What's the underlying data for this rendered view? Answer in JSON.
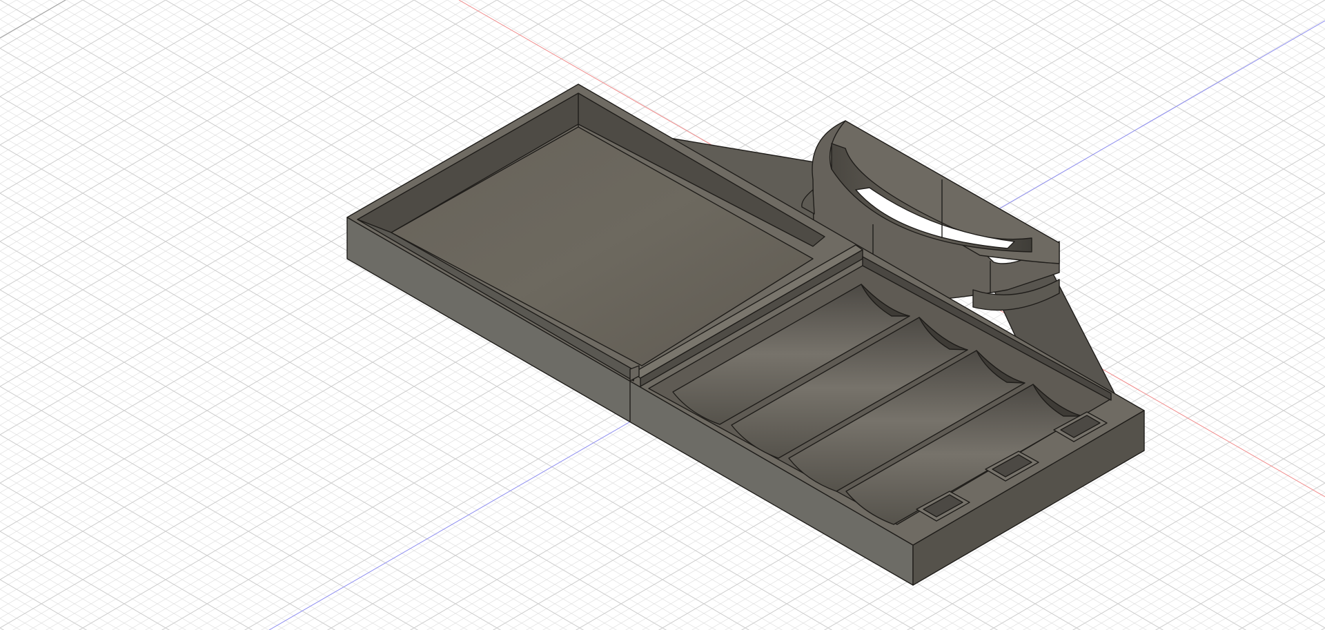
{
  "app": {
    "name": ""
  },
  "viewport": {
    "projection": "isometric",
    "grid_visible": true,
    "colors": {
      "background": "#ffffff",
      "grid_minor": "#e4e4e4",
      "grid_major": "#cfcfcf",
      "x_axis": "#f08a8a",
      "z_axis": "#8c8cf0",
      "part_top": "#6e6a62",
      "part_side_left": "#6f6e68",
      "part_side_right": "#55524b",
      "part_edge": "#1f1d1a"
    }
  },
  "model": {
    "body_name": "",
    "features": [
      "large-open-tray",
      "divider-wall",
      "four-pen-slots",
      "three-rectangular-pockets",
      "curved-cup-holder",
      "angled-gusset"
    ]
  }
}
